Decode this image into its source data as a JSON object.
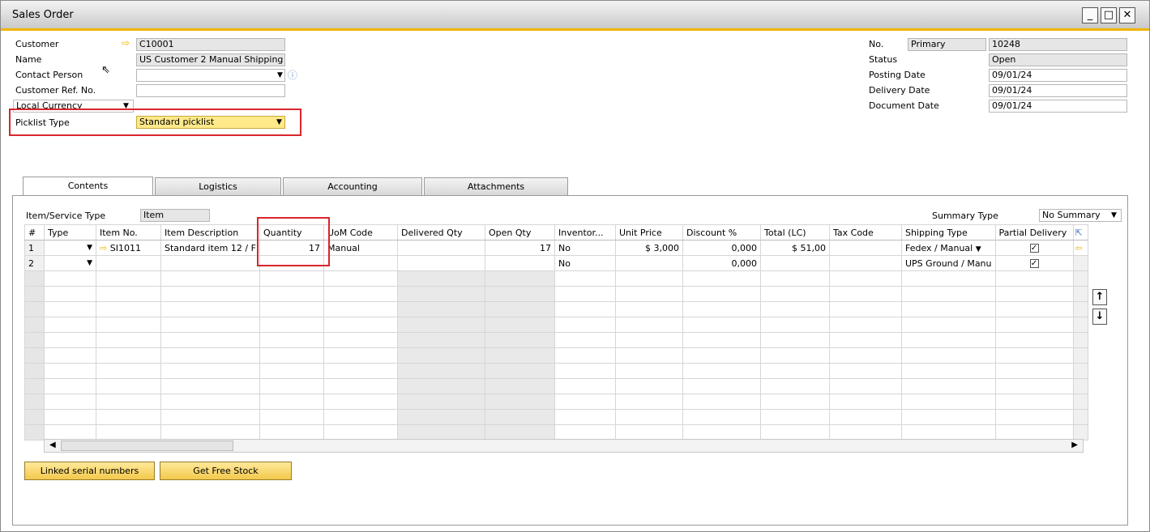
{
  "window": {
    "title": "Sales Order",
    "minimize": "_",
    "maximize": "□",
    "close": "✕"
  },
  "header": {
    "customer_label": "Customer",
    "customer_value": "C10001",
    "name_label": "Name",
    "name_value": "US Customer 2 Manual Shipping",
    "contact_label": "Contact Person",
    "contact_value": "",
    "ref_label": "Customer Ref. No.",
    "ref_value": "",
    "currency_label": "Local Currency",
    "picklist_label": "Picklist Type",
    "picklist_value": "Standard picklist",
    "no_label": "No.",
    "no_series": "Primary",
    "no_value": "10248",
    "status_label": "Status",
    "status_value": "Open",
    "posting_label": "Posting Date",
    "posting_value": "09/01/24",
    "delivery_label": "Delivery Date",
    "delivery_value": "09/01/24",
    "document_label": "Document Date",
    "document_value": "09/01/24"
  },
  "tabs": [
    "Contents",
    "Logistics",
    "Accounting",
    "Attachments"
  ],
  "contents": {
    "item_type_label": "Item/Service Type",
    "item_type_value": "Item",
    "summary_label": "Summary Type",
    "summary_value": "No Summary"
  },
  "grid": {
    "columns": [
      "#",
      "Type",
      "Item No.",
      "Item Description",
      "Quantity",
      "UoM Code",
      "Delivered Qty",
      "Open Qty",
      "Inventor...",
      "Unit Price",
      "Discount %",
      "Total (LC)",
      "Tax Code",
      "Shipping Type",
      "Partial Delivery"
    ],
    "rows": [
      {
        "num": "1",
        "type": "",
        "item_no": "SI1011",
        "desc": "Standard item 12 / F",
        "qty": "17",
        "uom": "Manual",
        "delivered": "",
        "open": "17",
        "inventory": "No",
        "price": "$ 3,000",
        "discount": "0,000",
        "total": "$ 51,00",
        "tax": "",
        "shipping": "Fedex / Manual",
        "partial": true
      },
      {
        "num": "2",
        "type": "",
        "item_no": "",
        "desc": "",
        "qty": "",
        "uom": "",
        "delivered": "",
        "open": "",
        "inventory": "No",
        "price": "",
        "discount": "0,000",
        "total": "",
        "tax": "",
        "shipping": "UPS Ground / Manu",
        "partial": true
      }
    ]
  },
  "buttons": {
    "linked_serial": "Linked serial numbers",
    "free_stock": "Get Free Stock"
  }
}
